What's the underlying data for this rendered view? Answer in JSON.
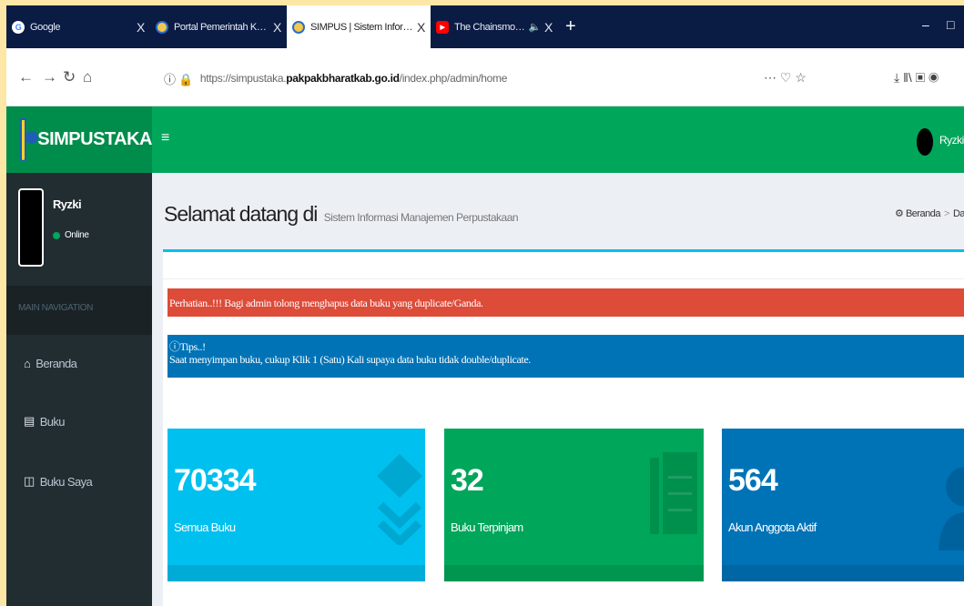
{
  "browser": {
    "tabs": [
      {
        "title": "Google",
        "icon": "google-icon",
        "active": false
      },
      {
        "title": "Portal Pemerintah Kabupaten Pa",
        "icon": "portal-favicon",
        "active": false
      },
      {
        "title": "SIMPUS | Sistem Informasi Mana",
        "icon": "simpus-favicon",
        "active": true
      },
      {
        "title": "The Chainsmokers - Closer (",
        "icon": "youtube-icon",
        "active": false
      }
    ],
    "close_glyph": "X",
    "new_tab_glyph": "+",
    "url_prefix": "https://simpustaka.",
    "url_host": "pakpakbharatkab.go.id",
    "url_path": "/index.php/admin/home",
    "page_actions": "⋯ ♡ ☆",
    "toolbar_icons": "⤓ ‖\\ ▣ ◉"
  },
  "app": {
    "brand": "SIMPUSTAKA",
    "toggle_glyph": "≡",
    "header_user": "Ryzki",
    "accent": "#00a65a"
  },
  "sidebar": {
    "user_name": "Ryzki",
    "status": "Online",
    "nav_header": "MAIN NAVIGATION",
    "items": [
      {
        "label": "Beranda",
        "icon": "home-icon",
        "glyph": "⌂"
      },
      {
        "label": "Buku",
        "icon": "book-icon",
        "glyph": "▤"
      },
      {
        "label": "Buku Saya",
        "icon": "columns-icon",
        "glyph": "◫"
      }
    ]
  },
  "content": {
    "title": "Selamat datang di",
    "subtitle": "Sistem Informasi Manajemen Perpustakaan",
    "breadcrumb_home": "Beranda",
    "breadcrumb_next": "Dasl",
    "alert_warning": "Perhatian..!!! Bagi admin tolong menghapus data buku yang duplicate/Ganda.",
    "tips_title": "Tips..!",
    "tips_body": "Saat menyimpan buku, cukup Klik 1 (Satu) Kali supaya data buku tidak double/duplicate."
  },
  "stats": [
    {
      "value": "70334",
      "label": "Semua Buku",
      "color": "#00c0ef",
      "icon": "stack-icon"
    },
    {
      "value": "32",
      "label": "Buku Terpinjam",
      "color": "#00a65a",
      "icon": "book-icon"
    },
    {
      "value": "564",
      "label": "Akun Anggota Aktif",
      "color": "#0073b7",
      "icon": "user-icon"
    }
  ]
}
